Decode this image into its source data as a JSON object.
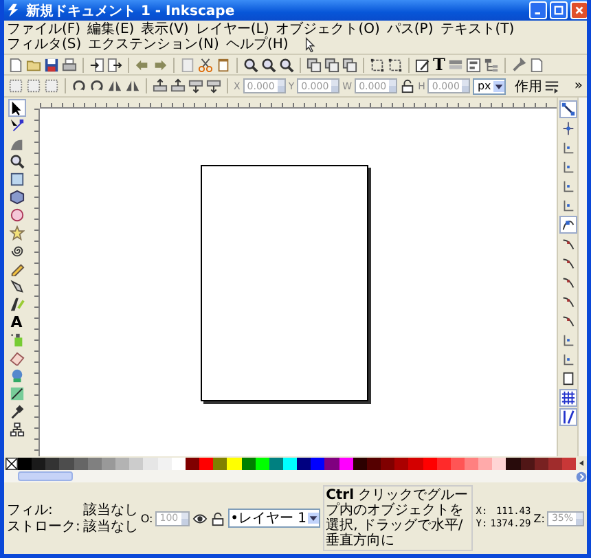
{
  "window": {
    "title": "新規ドキュメント 1 - Inkscape"
  },
  "menu": [
    {
      "label": "ファイル(F)"
    },
    {
      "label": "編集(E)"
    },
    {
      "label": "表示(V)"
    },
    {
      "label": "レイヤー(L)"
    },
    {
      "label": "オブジェクト(O)"
    },
    {
      "label": "パス(P)"
    },
    {
      "label": "テキスト(T)"
    },
    {
      "label": "フィルタ(S)"
    },
    {
      "label": "エクステンション(N)"
    },
    {
      "label": "ヘルプ(H)"
    }
  ],
  "commands_bar": {
    "text_glyph": "T"
  },
  "controls_bar": {
    "fields": [
      {
        "label": "X",
        "value": "0.000"
      },
      {
        "label": "Y",
        "value": "0.000"
      },
      {
        "label": "W",
        "value": "0.000"
      },
      {
        "label": "H",
        "value": "0.000"
      }
    ],
    "unit": "px",
    "affect_label": "作用",
    "overflow": "»"
  },
  "toolbox": {
    "tools": [
      {
        "kind": "selector",
        "selected": true
      },
      {
        "kind": "node",
        "selected": false
      },
      {
        "kind": "tweak",
        "selected": false
      },
      {
        "kind": "zoom",
        "selected": false
      },
      {
        "kind": "rect",
        "selected": false
      },
      {
        "kind": "box3d",
        "selected": false
      },
      {
        "kind": "ellipse",
        "selected": false
      },
      {
        "kind": "star",
        "selected": false
      },
      {
        "kind": "spiral",
        "selected": false
      },
      {
        "kind": "pencil",
        "selected": false
      },
      {
        "kind": "pen",
        "selected": false
      },
      {
        "kind": "calligraphy",
        "selected": false
      },
      {
        "kind": "text",
        "glyph": "A",
        "selected": false
      },
      {
        "kind": "spray",
        "selected": false
      },
      {
        "kind": "eraser",
        "selected": false
      },
      {
        "kind": "bucket",
        "selected": false
      },
      {
        "kind": "gradient",
        "selected": false
      },
      {
        "kind": "dropper",
        "selected": false
      },
      {
        "kind": "connector",
        "selected": false
      }
    ]
  },
  "snap_bar": [
    {
      "kind": "master",
      "on": true
    },
    {
      "kind": "node",
      "on": false
    },
    {
      "kind": "line",
      "on": false
    },
    {
      "kind": "line",
      "on": false
    },
    {
      "kind": "line",
      "on": false
    },
    {
      "kind": "line",
      "on": false
    },
    {
      "kind": "nodes",
      "on": true
    },
    {
      "kind": "curve",
      "on": false
    },
    {
      "kind": "curve",
      "on": false
    },
    {
      "kind": "curve",
      "on": false
    },
    {
      "kind": "curve",
      "on": false
    },
    {
      "kind": "curve",
      "on": false
    },
    {
      "kind": "line",
      "on": false
    },
    {
      "kind": "line",
      "on": false
    },
    {
      "kind": "page",
      "on": false
    },
    {
      "kind": "grid",
      "on": true
    },
    {
      "kind": "guide",
      "on": true
    }
  ],
  "palette": [
    {
      "color": "#000000"
    },
    {
      "color": "#1a1a1a"
    },
    {
      "color": "#333333"
    },
    {
      "color": "#4d4d4d"
    },
    {
      "color": "#666666"
    },
    {
      "color": "#808080"
    },
    {
      "color": "#999999"
    },
    {
      "color": "#b3b3b3"
    },
    {
      "color": "#cccccc"
    },
    {
      "color": "#e6e6e6"
    },
    {
      "color": "#f2f2f2"
    },
    {
      "color": "#ffffff"
    },
    {
      "color": "#800000"
    },
    {
      "color": "#ff0000"
    },
    {
      "color": "#808000"
    },
    {
      "color": "#ffff00"
    },
    {
      "color": "#008000"
    },
    {
      "color": "#00ff00"
    },
    {
      "color": "#008080"
    },
    {
      "color": "#00ffff"
    },
    {
      "color": "#000080"
    },
    {
      "color": "#0000ff"
    },
    {
      "color": "#800080"
    },
    {
      "color": "#ff00ff"
    },
    {
      "color": "#2b0000"
    },
    {
      "color": "#550000"
    },
    {
      "color": "#800000"
    },
    {
      "color": "#aa0000"
    },
    {
      "color": "#d40000"
    },
    {
      "color": "#ff0000"
    },
    {
      "color": "#ff2a2a"
    },
    {
      "color": "#ff5555"
    },
    {
      "color": "#ff8080"
    },
    {
      "color": "#ffaaaa"
    },
    {
      "color": "#ffd5d5"
    },
    {
      "color": "#280b0b"
    },
    {
      "color": "#501616"
    },
    {
      "color": "#782121"
    },
    {
      "color": "#a02c2c"
    },
    {
      "color": "#c83737"
    }
  ],
  "status_bar": {
    "fill_label": "フィル:",
    "fill_value": "該当なし",
    "stroke_label": "ストローク:",
    "stroke_value": "該当なし",
    "opacity_label": "O:",
    "opacity_value": "100",
    "layer": "•レイヤー 1",
    "message": "**Ctrl** クリックでグループ内のオブジェクトを選択, ドラッグで水平/垂直方向に",
    "x_label": "X:",
    "x_value": "111.43",
    "y_label": "Y:",
    "y_value": "1374.29",
    "zoom_label": "Z:",
    "zoom_value": "35%"
  }
}
